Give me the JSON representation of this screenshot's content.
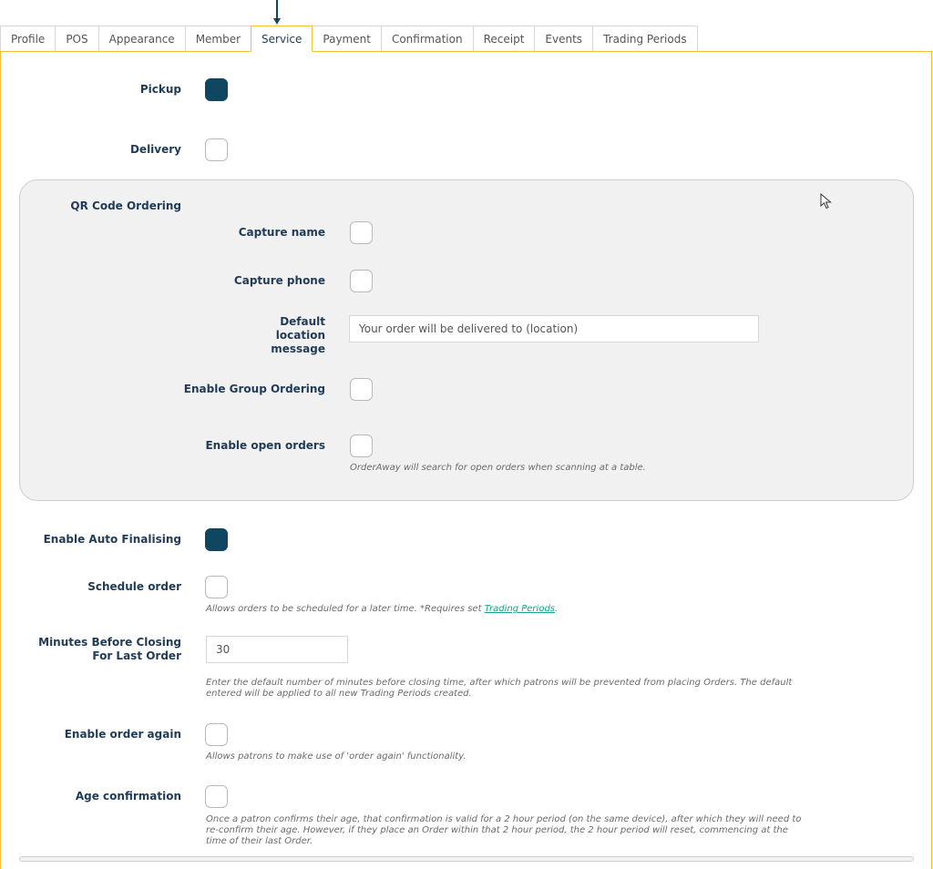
{
  "tabs": [
    "Profile",
    "POS",
    "Appearance",
    "Member",
    "Service",
    "Payment",
    "Confirmation",
    "Receipt",
    "Events",
    "Trading Periods"
  ],
  "active_tab": "Service",
  "form": {
    "pickup": {
      "label": "Pickup",
      "checked": true
    },
    "delivery": {
      "label": "Delivery",
      "checked": false
    },
    "qr": {
      "title": "QR Code Ordering",
      "capture_name": {
        "label": "Capture name",
        "checked": false
      },
      "capture_phone": {
        "label": "Capture phone",
        "checked": false
      },
      "default_location": {
        "label": "Default location message",
        "value": "Your order will be delivered to (location)"
      },
      "group_ordering": {
        "label": "Enable Group Ordering",
        "checked": false
      },
      "open_orders": {
        "label": "Enable open orders",
        "checked": false,
        "hint": "OrderAway will search for open orders when scanning at a table."
      }
    },
    "auto_finalising": {
      "label": "Enable Auto Finalising",
      "checked": true
    },
    "schedule_order": {
      "label": "Schedule order",
      "checked": false,
      "hint_prefix": "Allows orders to be scheduled for a later time. *Requires set ",
      "hint_link": "Trading Periods",
      "hint_suffix": "."
    },
    "minutes_before_closing": {
      "label": "Minutes Before Closing For Last Order",
      "value": "30",
      "hint": "Enter the default number of minutes before closing time, after which patrons will be prevented from placing Orders. The default entered will be applied to all new Trading Periods created."
    },
    "order_again": {
      "label": "Enable order again",
      "checked": false,
      "hint": "Allows patrons to make use of 'order again' functionality."
    },
    "age_confirmation": {
      "label": "Age confirmation",
      "checked": false,
      "hint": "Once a patron confirms their age, that confirmation is valid for a 2 hour period (on the same device), after which they will need to re-confirm their age. However, if they place an Order within that 2 hour period, the 2 hour period will reset, commencing at the time of their last Order."
    }
  },
  "colors": {
    "accent": "#f2c037",
    "checked": "#0f4660",
    "link": "#17a08a",
    "text": "#1f3b57"
  }
}
